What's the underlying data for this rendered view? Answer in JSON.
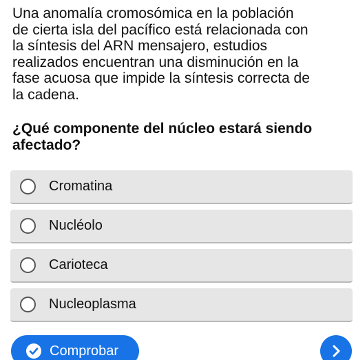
{
  "passage": {
    "lines": [
      "Una anomalía cromosómica en la población",
      "de cierta isla del pacífico está relacionada con",
      "la síntesis del ARN mensajero, estudios",
      "realizados encuentran una disminución en la",
      "fase acuosa que impide la síntesis correcta de",
      "la cadena."
    ]
  },
  "question": {
    "lines": [
      "¿Qué componente del núcleo estará siendo",
      "afectado?"
    ]
  },
  "options": [
    {
      "label": "Cromatina"
    },
    {
      "label": "Nucléolo"
    },
    {
      "label": "Carioteca"
    },
    {
      "label": "Nucleoplasma"
    }
  ],
  "actions": {
    "check_label": "Comprobar"
  },
  "icons": {
    "check": "check-circle-icon",
    "next": "chevron-right-icon"
  },
  "colors": {
    "accent": "#1873e6",
    "option_bg": "#e6e6e6",
    "text": "#111111"
  }
}
